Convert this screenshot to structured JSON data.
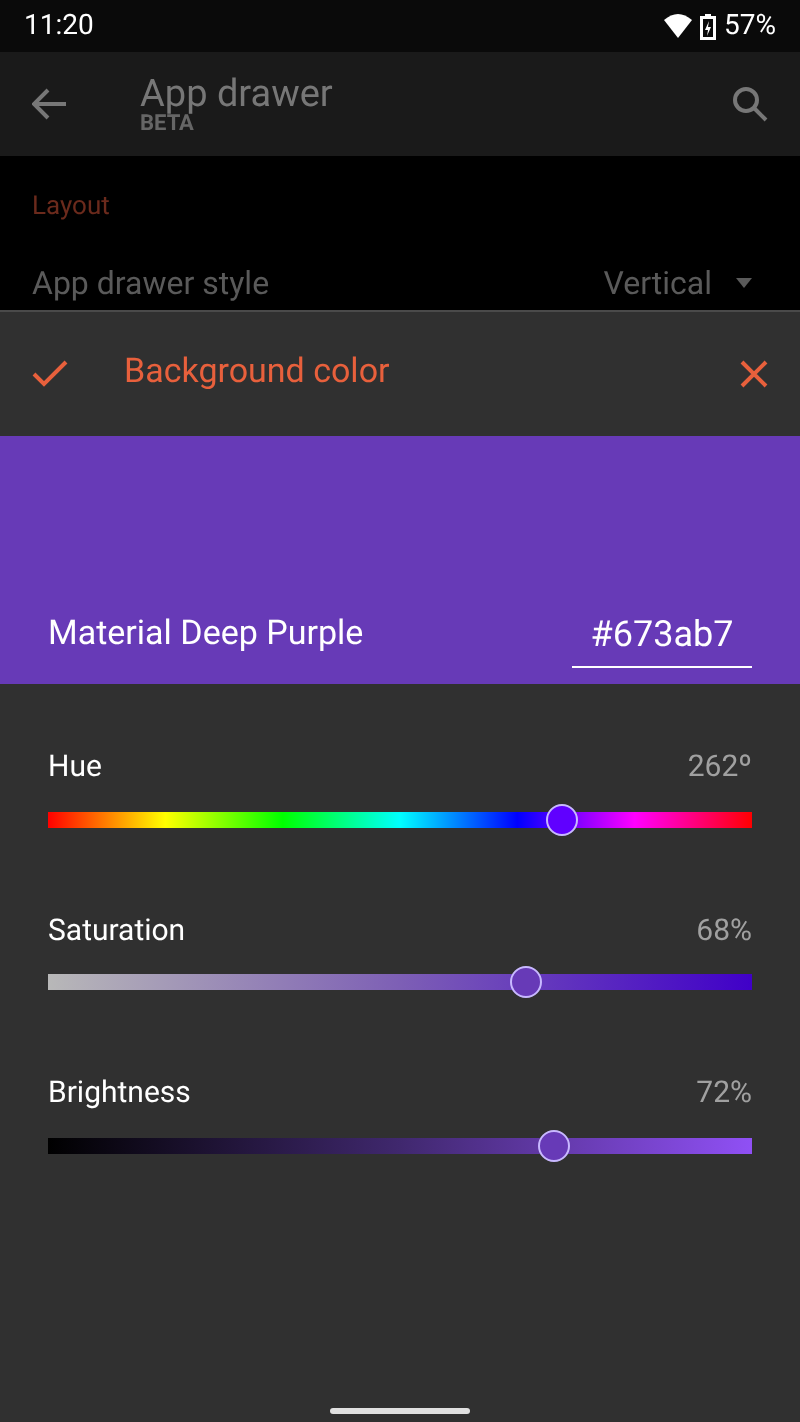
{
  "status_bar": {
    "time": "11:20",
    "battery": "57%"
  },
  "app_bar": {
    "title": "App drawer",
    "subtitle": "BETA"
  },
  "background": {
    "section": "Layout",
    "row_label": "App drawer style",
    "row_value": "Vertical"
  },
  "dialog": {
    "title": "Background color",
    "swatch": {
      "color": "#673ab7",
      "name": "Material Deep Purple",
      "hex": "#673ab7"
    },
    "sliders": [
      {
        "kind": "hue",
        "label": "Hue",
        "reading": "262º",
        "level": 0.729
      },
      {
        "kind": "saturation",
        "label": "Saturation",
        "reading": "68%",
        "level": 0.678
      },
      {
        "kind": "brightness",
        "label": "Brightness",
        "reading": "72%",
        "level": 0.718
      }
    ]
  }
}
